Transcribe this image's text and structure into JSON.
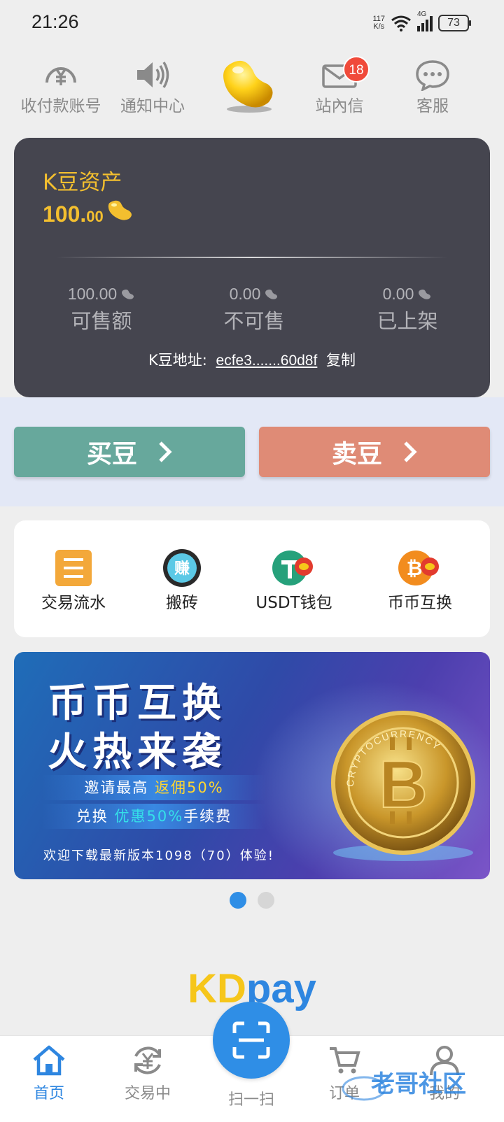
{
  "status_bar": {
    "time": "21:26",
    "net_speed_top": "117",
    "net_speed_bottom": "K/s",
    "network_type": "4G",
    "battery": "73"
  },
  "top_nav": {
    "items": [
      {
        "label": "收付款账号",
        "icon": "yen-circle-icon"
      },
      {
        "label": "通知中心",
        "icon": "speaker-icon"
      },
      {
        "label": "站內信",
        "icon": "mail-icon",
        "badge": "18"
      },
      {
        "label": "客服",
        "icon": "chat-bubble-icon"
      }
    ],
    "center_icon": "golden-bean-logo"
  },
  "asset_card": {
    "title": "K豆资产",
    "amount_int": "100.",
    "amount_dec": "00",
    "stats": [
      {
        "value": "100.00",
        "label": "可售额"
      },
      {
        "value": "0.00",
        "label": "不可售"
      },
      {
        "value": "0.00",
        "label": "已上架"
      }
    ],
    "address_label": "K豆地址:",
    "address_value": "ecfe3.......60d8f",
    "copy_label": "复制"
  },
  "actions": {
    "buy_label": "买豆",
    "sell_label": "卖豆",
    "buy_color": "#67a89c",
    "sell_color": "#df8b76"
  },
  "tools": [
    {
      "label": "交易流水",
      "icon": "ledger-icon"
    },
    {
      "label": "搬砖",
      "icon": "earn-icon"
    },
    {
      "label": "USDT钱包",
      "icon": "tether-icon"
    },
    {
      "label": "币币互换",
      "icon": "bitcoin-swap-icon"
    }
  ],
  "banner": {
    "line1": "币币互换",
    "line2": "火热来袭",
    "promo1_pre": "邀请最高 ",
    "promo1_hl": "返佣50%",
    "promo2_pre": "兑换 ",
    "promo2_hl": "优惠50%",
    "promo2_post": "手续费",
    "footer": "欢迎下载最新版本1098（70）体验!",
    "coin_text": "CRYPTOCURRENCY"
  },
  "carousel": {
    "count": 2,
    "active": 0
  },
  "brand": {
    "kd": "KD",
    "pay": "pay"
  },
  "tabbar": {
    "items": [
      {
        "label": "首页",
        "icon": "home-icon",
        "active": true
      },
      {
        "label": "交易中",
        "icon": "yen-cycle-icon"
      },
      {
        "label": "订单",
        "icon": "cart-icon"
      },
      {
        "label": "我的",
        "icon": "person-icon"
      }
    ],
    "scan_label": "扫一扫",
    "accent": "#2f8ee6"
  },
  "watermark": "老哥社区"
}
